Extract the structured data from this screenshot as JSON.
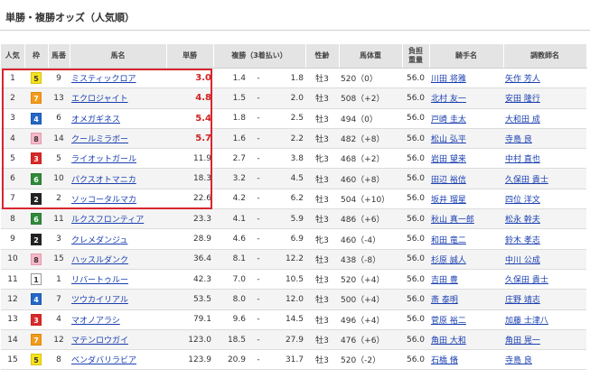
{
  "page_title": "単勝・複勝オッズ（人気順）",
  "headers": {
    "ninki": "人気",
    "waku": "枠",
    "umaban": "馬番",
    "horse": "馬名",
    "tansho": "単勝",
    "fukusho": "複勝（3着払い）",
    "sexage": "性齢",
    "weight": "馬体重",
    "futan_1": "負担",
    "futan_2": "重量",
    "jockey": "騎手名",
    "trainer": "調教師名"
  },
  "colors": {
    "highlight_box": "#d8262f",
    "odds_highlight": "#d22020",
    "link": "#1a3fb0"
  },
  "rows": [
    {
      "ninki": "1",
      "waku": "5",
      "umaban": "9",
      "horse": "ミスティックロア",
      "tansho": "3.0",
      "fuku_min": "1.4",
      "fuku_sep": "-",
      "fuku_max": "1.8",
      "sexage": "牡3",
      "weight": "520（0）",
      "futan": "56.0",
      "jockey": "川田 将雅",
      "trainer": "矢作 芳人",
      "hi": true
    },
    {
      "ninki": "2",
      "waku": "7",
      "umaban": "13",
      "horse": "エクロジャイト",
      "tansho": "4.8",
      "fuku_min": "1.5",
      "fuku_sep": "-",
      "fuku_max": "2.0",
      "sexage": "牡3",
      "weight": "508（+2）",
      "futan": "56.0",
      "jockey": "北村 友一",
      "trainer": "安田 隆行",
      "hi": true
    },
    {
      "ninki": "3",
      "waku": "4",
      "umaban": "6",
      "horse": "オメガギネス",
      "tansho": "5.4",
      "fuku_min": "1.8",
      "fuku_sep": "-",
      "fuku_max": "2.5",
      "sexage": "牡3",
      "weight": "494（0）",
      "futan": "56.0",
      "jockey": "戸崎 圭太",
      "trainer": "大和田 成",
      "hi": true
    },
    {
      "ninki": "4",
      "waku": "8",
      "umaban": "14",
      "horse": "クールミラボー",
      "tansho": "5.7",
      "fuku_min": "1.6",
      "fuku_sep": "-",
      "fuku_max": "2.2",
      "sexage": "牡3",
      "weight": "482（+8）",
      "futan": "56.0",
      "jockey": "松山 弘平",
      "trainer": "寺島 良",
      "hi": true
    },
    {
      "ninki": "5",
      "waku": "3",
      "umaban": "5",
      "horse": "ライオットガール",
      "tansho": "11.9",
      "fuku_min": "2.7",
      "fuku_sep": "-",
      "fuku_max": "3.8",
      "sexage": "牝3",
      "weight": "468（+2）",
      "futan": "56.0",
      "jockey": "岩田 望来",
      "trainer": "中村 直也",
      "hi": false
    },
    {
      "ninki": "6",
      "waku": "6",
      "umaban": "10",
      "horse": "パクスオトマニカ",
      "tansho": "18.3",
      "fuku_min": "3.2",
      "fuku_sep": "-",
      "fuku_max": "4.5",
      "sexage": "牡3",
      "weight": "460（+8）",
      "futan": "56.0",
      "jockey": "田辺 裕信",
      "trainer": "久保田 貴士",
      "hi": false
    },
    {
      "ninki": "7",
      "waku": "2",
      "umaban": "2",
      "horse": "ソッコータルマカ",
      "tansho": "22.6",
      "fuku_min": "4.2",
      "fuku_sep": "-",
      "fuku_max": "6.2",
      "sexage": "牡3",
      "weight": "504（+10）",
      "futan": "56.0",
      "jockey": "坂井 瑠星",
      "trainer": "四位 洋文",
      "hi": false
    },
    {
      "ninki": "8",
      "waku": "6",
      "umaban": "11",
      "horse": "ルクスフロンティア",
      "tansho": "23.3",
      "fuku_min": "4.1",
      "fuku_sep": "-",
      "fuku_max": "5.9",
      "sexage": "牡3",
      "weight": "486（+6）",
      "futan": "56.0",
      "jockey": "秋山 真一郎",
      "trainer": "松永 幹夫",
      "hi": false
    },
    {
      "ninki": "9",
      "waku": "2",
      "umaban": "3",
      "horse": "クレメダンジュ",
      "tansho": "28.9",
      "fuku_min": "4.6",
      "fuku_sep": "-",
      "fuku_max": "6.9",
      "sexage": "牝3",
      "weight": "460（-4）",
      "futan": "56.0",
      "jockey": "和田 竜二",
      "trainer": "鈴木 孝志",
      "hi": false
    },
    {
      "ninki": "10",
      "waku": "8",
      "umaban": "15",
      "horse": "ハッスルダンク",
      "tansho": "36.4",
      "fuku_min": "8.1",
      "fuku_sep": "-",
      "fuku_max": "12.2",
      "sexage": "牡3",
      "weight": "438（-8）",
      "futan": "56.0",
      "jockey": "杉原 誠人",
      "trainer": "中川 公成",
      "hi": false
    },
    {
      "ninki": "11",
      "waku": "1",
      "umaban": "1",
      "horse": "リバートゥルー",
      "tansho": "42.3",
      "fuku_min": "7.0",
      "fuku_sep": "-",
      "fuku_max": "10.5",
      "sexage": "牡3",
      "weight": "520（+4）",
      "futan": "56.0",
      "jockey": "吉田 豊",
      "trainer": "久保田 貴士",
      "hi": false
    },
    {
      "ninki": "12",
      "waku": "4",
      "umaban": "7",
      "horse": "ツウカイリアル",
      "tansho": "53.5",
      "fuku_min": "8.0",
      "fuku_sep": "-",
      "fuku_max": "12.0",
      "sexage": "牡3",
      "weight": "500（+4）",
      "futan": "56.0",
      "jockey": "斎 泰明",
      "trainer": "庄野 靖志",
      "hi": false
    },
    {
      "ninki": "13",
      "waku": "3",
      "umaban": "4",
      "horse": "マオノアラシ",
      "tansho": "79.1",
      "fuku_min": "9.6",
      "fuku_sep": "-",
      "fuku_max": "14.5",
      "sexage": "牡3",
      "weight": "496（+4）",
      "futan": "56.0",
      "jockey": "菅原 裕二",
      "trainer": "加藤 士津八",
      "hi": false
    },
    {
      "ninki": "14",
      "waku": "7",
      "umaban": "12",
      "horse": "マテンロウガイ",
      "tansho": "123.0",
      "fuku_min": "18.5",
      "fuku_sep": "-",
      "fuku_max": "27.9",
      "sexage": "牡3",
      "weight": "476（+6）",
      "futan": "56.0",
      "jockey": "角田 大和",
      "trainer": "角田 晃一",
      "hi": false
    },
    {
      "ninki": "15",
      "waku": "5",
      "umaban": "8",
      "horse": "ベンダバリラビア",
      "tansho": "123.9",
      "fuku_min": "20.9",
      "fuku_sep": "-",
      "fuku_max": "31.7",
      "sexage": "牡3",
      "weight": "520（-2）",
      "futan": "56.0",
      "jockey": "石橋 脩",
      "trainer": "寺島 良",
      "hi": false
    }
  ]
}
